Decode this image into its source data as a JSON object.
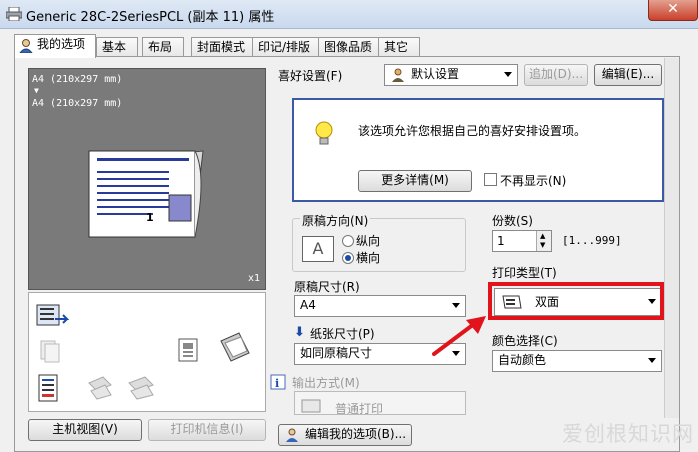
{
  "window": {
    "title": "Generic 28C-2SeriesPCL (副本 11) 属性",
    "close_glyph": "✕"
  },
  "tabs": [
    "我的选项",
    "基本",
    "布局",
    "封面模式",
    "印记/排版",
    "图像品质",
    "其它"
  ],
  "preview": {
    "line1": "A4 (210x297 mm)",
    "arrow": "▼",
    "line2": "A4 (210x297 mm)",
    "page_count": "x1",
    "page_number": "1"
  },
  "left_buttons": {
    "main_view": "主机视图(V)",
    "printer_info": "打印机信息(I)"
  },
  "favorites": {
    "label": "喜好设置(F)",
    "selected": "默认设置",
    "add_button": "追加(D)...",
    "edit_button": "编辑(E)..."
  },
  "info": {
    "message": "该选项允许您根据自己的喜好安排设置项。",
    "more_button": "更多详情(M)",
    "dont_show_label": "不再显示(N)"
  },
  "orientation": {
    "label": "原稿方向(N)",
    "icon_letter": "A",
    "options": [
      "纵向",
      "横向"
    ],
    "selected_index": 1
  },
  "original_size": {
    "label": "原稿尺寸(R)",
    "value": "A4"
  },
  "paper_size": {
    "label": "纸张尺寸(P)",
    "value": "如同原稿尺寸"
  },
  "output_method": {
    "label": "输出方式(M)",
    "value": "普通打印"
  },
  "copies": {
    "label": "份数(S)",
    "value": "1",
    "range": "[1...999]"
  },
  "print_type": {
    "label": "打印类型(T)",
    "value": "双面"
  },
  "color": {
    "label": "颜色选择(C)",
    "value": "自动颜色"
  },
  "bottom": {
    "edit_my_options": "编辑我的选项(B)..."
  },
  "watermark": "爱创根知识网",
  "colors": {
    "highlight_red": "#e0141a",
    "arrow_red": "#e0141a",
    "accent_blue": "#1b4aa8"
  }
}
